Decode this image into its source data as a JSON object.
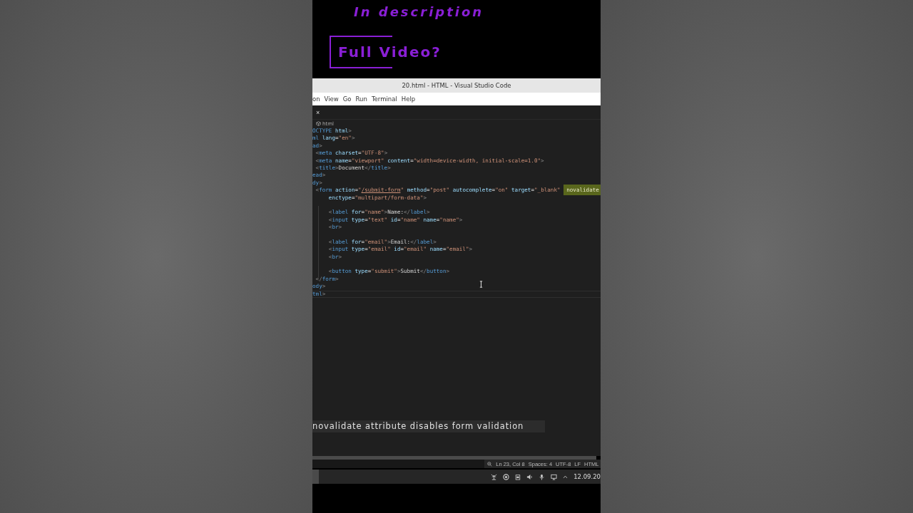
{
  "video_overlay": {
    "line_1": "In description",
    "line_2": "Full Video?"
  },
  "window": {
    "title": "20.html - HTML - Visual Studio Code"
  },
  "menu": [
    "on",
    "View",
    "Go",
    "Run",
    "Terminal",
    "Help"
  ],
  "tab": {
    "close": "×"
  },
  "breadcrumb": {
    "label": "html"
  },
  "editor": {
    "lines": [
      {
        "kind": "code",
        "tokens": [
          {
            "kind": "tag",
            "text": "OCTYPE"
          },
          {
            "kind": "attr",
            "text": " html"
          },
          {
            "kind": "punct",
            "text": ">"
          }
        ]
      },
      {
        "kind": "code",
        "tokens": [
          {
            "kind": "tag",
            "text": "ml"
          },
          {
            "kind": "attr",
            "text": " lang"
          },
          {
            "kind": "text",
            "text": "="
          },
          {
            "kind": "str",
            "text": "\"en\""
          },
          {
            "kind": "punct",
            "text": ">"
          }
        ]
      },
      {
        "kind": "code",
        "tokens": [
          {
            "kind": "tag",
            "text": "ad"
          },
          {
            "kind": "punct",
            "text": ">"
          }
        ]
      },
      {
        "kind": "code",
        "tokens": [
          {
            "kind": "punct",
            "text": " <"
          },
          {
            "kind": "tag",
            "text": "meta"
          },
          {
            "kind": "attr",
            "text": " charset"
          },
          {
            "kind": "text",
            "text": "="
          },
          {
            "kind": "str",
            "text": "\"UTF-8\""
          },
          {
            "kind": "punct",
            "text": ">"
          }
        ]
      },
      {
        "kind": "code",
        "tokens": [
          {
            "kind": "punct",
            "text": " <"
          },
          {
            "kind": "tag",
            "text": "meta"
          },
          {
            "kind": "attr",
            "text": " name"
          },
          {
            "kind": "text",
            "text": "="
          },
          {
            "kind": "str",
            "text": "\"viewport\""
          },
          {
            "kind": "attr",
            "text": " content"
          },
          {
            "kind": "text",
            "text": "="
          },
          {
            "kind": "str",
            "text": "\"width=device-width, initial-scale=1.0\""
          },
          {
            "kind": "punct",
            "text": ">"
          }
        ]
      },
      {
        "kind": "code",
        "tokens": [
          {
            "kind": "punct",
            "text": " <"
          },
          {
            "kind": "tag",
            "text": "title"
          },
          {
            "kind": "punct",
            "text": ">"
          },
          {
            "kind": "text",
            "text": "Document"
          },
          {
            "kind": "punct",
            "text": "</"
          },
          {
            "kind": "tag",
            "text": "title"
          },
          {
            "kind": "punct",
            "text": ">"
          }
        ]
      },
      {
        "kind": "code",
        "tokens": [
          {
            "kind": "tag",
            "text": "ead"
          },
          {
            "kind": "punct",
            "text": ">"
          }
        ]
      },
      {
        "kind": "code",
        "tokens": [
          {
            "kind": "tag",
            "text": "dy"
          },
          {
            "kind": "punct",
            "text": ">"
          }
        ]
      },
      {
        "kind": "code",
        "tokens": [
          {
            "kind": "punct",
            "text": " <"
          },
          {
            "kind": "tag",
            "text": "form"
          },
          {
            "kind": "attr",
            "text": " action"
          },
          {
            "kind": "text",
            "text": "="
          },
          {
            "kind": "str",
            "text": "\""
          },
          {
            "kind": "link",
            "text": "/submit-form"
          },
          {
            "kind": "str",
            "text": "\""
          },
          {
            "kind": "attr",
            "text": " method"
          },
          {
            "kind": "text",
            "text": "="
          },
          {
            "kind": "str",
            "text": "\"post\""
          },
          {
            "kind": "attr",
            "text": " autocomplete"
          },
          {
            "kind": "text",
            "text": "="
          },
          {
            "kind": "str",
            "text": "\"on\""
          },
          {
            "kind": "attr",
            "text": " target"
          },
          {
            "kind": "text",
            "text": "="
          },
          {
            "kind": "str",
            "text": "\"_blank\" "
          },
          {
            "kind": "highlight",
            "text": "novalidate"
          }
        ]
      },
      {
        "kind": "code",
        "tokens": [
          {
            "kind": "attr",
            "text": "     enctype"
          },
          {
            "kind": "text",
            "text": "="
          },
          {
            "kind": "str",
            "text": "\"multipart/form-data\""
          },
          {
            "kind": "punct",
            "text": ">"
          }
        ]
      },
      {
        "kind": "blank"
      },
      {
        "kind": "code",
        "tokens": [
          {
            "kind": "punct",
            "text": "     <"
          },
          {
            "kind": "tag",
            "text": "label"
          },
          {
            "kind": "attr",
            "text": " for"
          },
          {
            "kind": "text",
            "text": "="
          },
          {
            "kind": "str",
            "text": "\"name\""
          },
          {
            "kind": "punct",
            "text": ">"
          },
          {
            "kind": "text",
            "text": "Name:"
          },
          {
            "kind": "punct",
            "text": "</"
          },
          {
            "kind": "tag",
            "text": "label"
          },
          {
            "kind": "punct",
            "text": ">"
          }
        ]
      },
      {
        "kind": "code",
        "tokens": [
          {
            "kind": "punct",
            "text": "     <"
          },
          {
            "kind": "tag",
            "text": "input"
          },
          {
            "kind": "attr",
            "text": " type"
          },
          {
            "kind": "text",
            "text": "="
          },
          {
            "kind": "str",
            "text": "\"text\""
          },
          {
            "kind": "attr",
            "text": " id"
          },
          {
            "kind": "text",
            "text": "="
          },
          {
            "kind": "str",
            "text": "\"name\""
          },
          {
            "kind": "attr",
            "text": " name"
          },
          {
            "kind": "text",
            "text": "="
          },
          {
            "kind": "str",
            "text": "\"name\""
          },
          {
            "kind": "punct",
            "text": ">"
          }
        ]
      },
      {
        "kind": "code",
        "tokens": [
          {
            "kind": "punct",
            "text": "     <"
          },
          {
            "kind": "tag",
            "text": "br"
          },
          {
            "kind": "punct",
            "text": ">"
          }
        ]
      },
      {
        "kind": "blank"
      },
      {
        "kind": "code",
        "tokens": [
          {
            "kind": "punct",
            "text": "     <"
          },
          {
            "kind": "tag",
            "text": "label"
          },
          {
            "kind": "attr",
            "text": " for"
          },
          {
            "kind": "text",
            "text": "="
          },
          {
            "kind": "str",
            "text": "\"email\""
          },
          {
            "kind": "punct",
            "text": ">"
          },
          {
            "kind": "text",
            "text": "Email:"
          },
          {
            "kind": "punct",
            "text": "</"
          },
          {
            "kind": "tag",
            "text": "label"
          },
          {
            "kind": "punct",
            "text": ">"
          }
        ]
      },
      {
        "kind": "code",
        "tokens": [
          {
            "kind": "punct",
            "text": "     <"
          },
          {
            "kind": "tag",
            "text": "input"
          },
          {
            "kind": "attr",
            "text": " type"
          },
          {
            "kind": "text",
            "text": "="
          },
          {
            "kind": "str",
            "text": "\"email\""
          },
          {
            "kind": "attr",
            "text": " id"
          },
          {
            "kind": "text",
            "text": "="
          },
          {
            "kind": "str",
            "text": "\"email\""
          },
          {
            "kind": "attr",
            "text": " name"
          },
          {
            "kind": "text",
            "text": "="
          },
          {
            "kind": "str",
            "text": "\"email\""
          },
          {
            "kind": "punct",
            "text": ">"
          }
        ]
      },
      {
        "kind": "code",
        "tokens": [
          {
            "kind": "punct",
            "text": "     <"
          },
          {
            "kind": "tag",
            "text": "br"
          },
          {
            "kind": "punct",
            "text": ">"
          }
        ]
      },
      {
        "kind": "blank"
      },
      {
        "kind": "code",
        "tokens": [
          {
            "kind": "punct",
            "text": "     <"
          },
          {
            "kind": "tag",
            "text": "button"
          },
          {
            "kind": "attr",
            "text": " type"
          },
          {
            "kind": "text",
            "text": "="
          },
          {
            "kind": "str",
            "text": "\"submit\""
          },
          {
            "kind": "punct",
            "text": ">"
          },
          {
            "kind": "text",
            "text": "Submit"
          },
          {
            "kind": "punct",
            "text": "</"
          },
          {
            "kind": "tag",
            "text": "button"
          },
          {
            "kind": "punct",
            "text": ">"
          }
        ]
      },
      {
        "kind": "code",
        "tokens": [
          {
            "kind": "punct",
            "text": " </"
          },
          {
            "kind": "tag",
            "text": "form"
          },
          {
            "kind": "punct",
            "text": ">"
          }
        ]
      },
      {
        "kind": "code",
        "tokens": [
          {
            "kind": "tag",
            "text": "ody"
          },
          {
            "kind": "punct",
            "text": ">"
          }
        ]
      },
      {
        "kind": "code",
        "current": true,
        "tokens": [
          {
            "kind": "tag",
            "text": "tml"
          },
          {
            "kind": "punct",
            "text": ">"
          }
        ]
      }
    ]
  },
  "caption": "novalidate attribute disables form validation",
  "status_bar": {
    "items": [
      "Ln 23, Col 8",
      "Spaces: 4",
      "UTF-8",
      "LF",
      "HTML"
    ]
  },
  "taskbar": {
    "clock": "12.09.20"
  }
}
